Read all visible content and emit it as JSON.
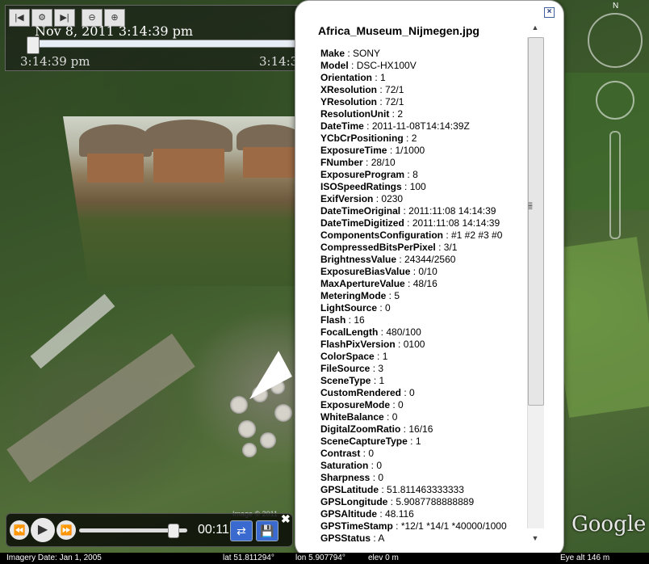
{
  "timeslider": {
    "date": "Nov  8, 2011    3:14:39 pm",
    "start_time": "3:14:39 pm",
    "end_time": "3:14:3",
    "buttons": [
      "step-back-icon",
      "settings-icon",
      "step-forward-icon",
      "zoom-out-icon",
      "zoom-in-icon"
    ]
  },
  "balloon": {
    "title": "Africa_Museum_Nijmegen.jpg",
    "close_label": "×",
    "fields": [
      {
        "key": "Make",
        "value": "SONY"
      },
      {
        "key": "Model",
        "value": "DSC-HX100V"
      },
      {
        "key": "Orientation",
        "value": "1"
      },
      {
        "key": "XResolution",
        "value": "72/1"
      },
      {
        "key": "YResolution",
        "value": "72/1"
      },
      {
        "key": "ResolutionUnit",
        "value": "2"
      },
      {
        "key": "DateTime",
        "value": "2011-11-08T14:14:39Z"
      },
      {
        "key": "YCbCrPositioning",
        "value": "2"
      },
      {
        "key": "ExposureTime",
        "value": "1/1000"
      },
      {
        "key": "FNumber",
        "value": "28/10"
      },
      {
        "key": "ExposureProgram",
        "value": "8"
      },
      {
        "key": "ISOSpeedRatings",
        "value": "100"
      },
      {
        "key": "ExifVersion",
        "value": "0230"
      },
      {
        "key": "DateTimeOriginal",
        "value": "2011:11:08 14:14:39"
      },
      {
        "key": "DateTimeDigitized",
        "value": "2011:11:08 14:14:39"
      },
      {
        "key": "ComponentsConfiguration",
        "value": "#1 #2 #3 #0"
      },
      {
        "key": "CompressedBitsPerPixel",
        "value": "3/1"
      },
      {
        "key": "BrightnessValue",
        "value": "24344/2560"
      },
      {
        "key": "ExposureBiasValue",
        "value": "0/10"
      },
      {
        "key": "MaxApertureValue",
        "value": "48/16"
      },
      {
        "key": "MeteringMode",
        "value": "5"
      },
      {
        "key": "LightSource",
        "value": "0"
      },
      {
        "key": "Flash",
        "value": "16"
      },
      {
        "key": "FocalLength",
        "value": "480/100"
      },
      {
        "key": "FlashPixVersion",
        "value": "0100"
      },
      {
        "key": "ColorSpace",
        "value": "1"
      },
      {
        "key": "FileSource",
        "value": "3"
      },
      {
        "key": "SceneType",
        "value": "1"
      },
      {
        "key": "CustomRendered",
        "value": "0"
      },
      {
        "key": "ExposureMode",
        "value": "0"
      },
      {
        "key": "WhiteBalance",
        "value": "0"
      },
      {
        "key": "DigitalZoomRatio",
        "value": "16/16"
      },
      {
        "key": "SceneCaptureType",
        "value": "1"
      },
      {
        "key": "Contrast",
        "value": "0"
      },
      {
        "key": "Saturation",
        "value": "0"
      },
      {
        "key": "Sharpness",
        "value": "0"
      },
      {
        "key": "GPSLatitude",
        "value": "51.811463333333"
      },
      {
        "key": "GPSLongitude",
        "value": "5.9087788888889"
      },
      {
        "key": "GPSAltitude",
        "value": "48.116"
      },
      {
        "key": "GPSTimeStamp",
        "value": "*12/1 *14/1 *40000/1000"
      },
      {
        "key": "GPSStatus",
        "value": "A"
      }
    ],
    "scroll_up_icon": "arrow-up-icon",
    "scroll_down_icon": "arrow-down-icon"
  },
  "navigation": {
    "north_label": "N"
  },
  "tour": {
    "time": "00:11",
    "close_label": "✖"
  },
  "map": {
    "copyright": "Image © 2011",
    "logo": "Google"
  },
  "statusbar": {
    "imagery_date": "Imagery Date: Jan  1, 2005",
    "lat": "lat   51.811294°",
    "lon": "lon   5.907794°",
    "elev": "elev   0 m",
    "eye_alt": "Eye alt   146 m"
  },
  "colors": {
    "balloon_bg": "#ffffff",
    "timeline_fill": "#4a80c0",
    "tour_button": "#3a6ad0",
    "statusbar_bg": "#000000"
  }
}
